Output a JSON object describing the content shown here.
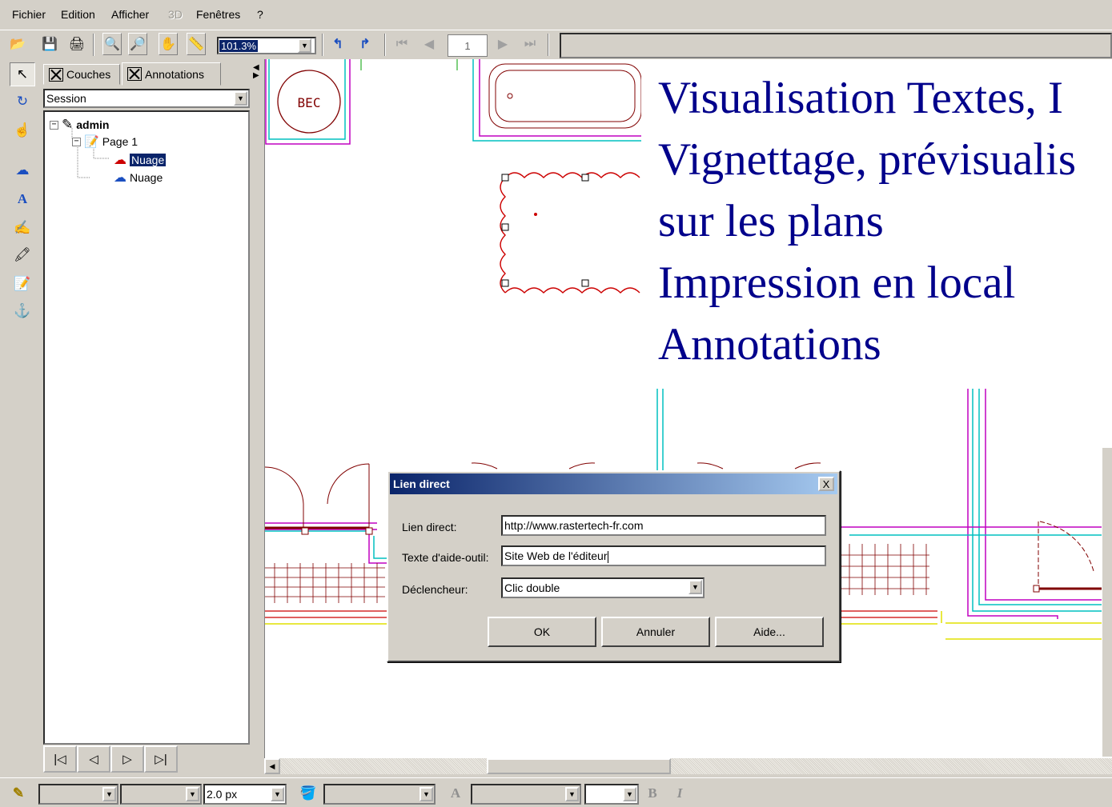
{
  "menu": {
    "items": [
      "Fichier",
      "Edition",
      "Afficher",
      "3D",
      "Fenêtres",
      "?"
    ]
  },
  "toolbar": {
    "zoom": "101.3%",
    "page": "1"
  },
  "panel": {
    "tabs": [
      "Couches",
      "Annotations"
    ],
    "session": "Session",
    "tree": {
      "root": "admin",
      "page": "Page 1",
      "items": [
        "Nuage",
        "Nuage"
      ]
    }
  },
  "overlay": {
    "lines": [
      "Visualisation Textes, I",
      "Vignettage, prévisualis",
      "sur les plans",
      "Impression en local",
      "Annotations"
    ]
  },
  "plan": {
    "bec_label": "BEC"
  },
  "dialog": {
    "title": "Lien direct",
    "close": "X",
    "link_label": "Lien direct:",
    "link_value": "http://www.rastertech-fr.com",
    "tooltip_label": "Texte d'aide-outil:",
    "tooltip_value": "Site Web de l'éditeur",
    "trigger_label": "Déclencheur:",
    "trigger_value": "Clic double",
    "ok": "OK",
    "cancel": "Annuler",
    "help": "Aide..."
  },
  "bottombar": {
    "line_width": "2.0 px"
  },
  "colors": {
    "title_start": "#0a246a",
    "title_end": "#a6caf0",
    "overlay_text": "#00008b",
    "selection": "#0a246a",
    "cloud": "#cc0000"
  }
}
